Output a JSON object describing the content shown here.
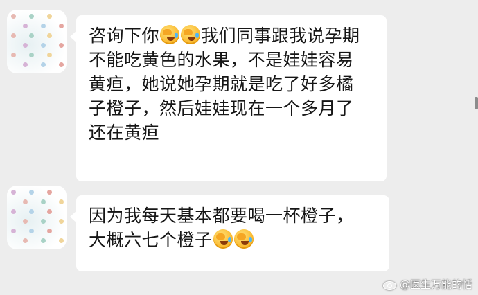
{
  "messages": [
    {
      "lines": [
        [
          "咨询下你",
          "emoji:facepalm",
          "emoji:facepalm",
          "我们同事跟我说孕期"
        ],
        [
          "不能吃黄色的水果，不是娃娃容易"
        ],
        [
          "黄疸，她说她孕期就是吃了好多橘"
        ],
        [
          "子橙子，然后娃娃现在一个多月了"
        ],
        [
          "还在黄疸"
        ]
      ]
    },
    {
      "lines": [
        [
          "因为我每天基本都要喝一杯橙子，"
        ],
        [
          "大概六七个橙子",
          "emoji:facepalm",
          "emoji:facepalm"
        ]
      ]
    }
  ],
  "watermark": "@医生万能的恬",
  "icons": {
    "emoji": "facepalm-emoji",
    "watermark": "weibo-icon"
  },
  "colors": {
    "background": "#ededed",
    "bubble": "#ffffff",
    "text": "#161616"
  }
}
